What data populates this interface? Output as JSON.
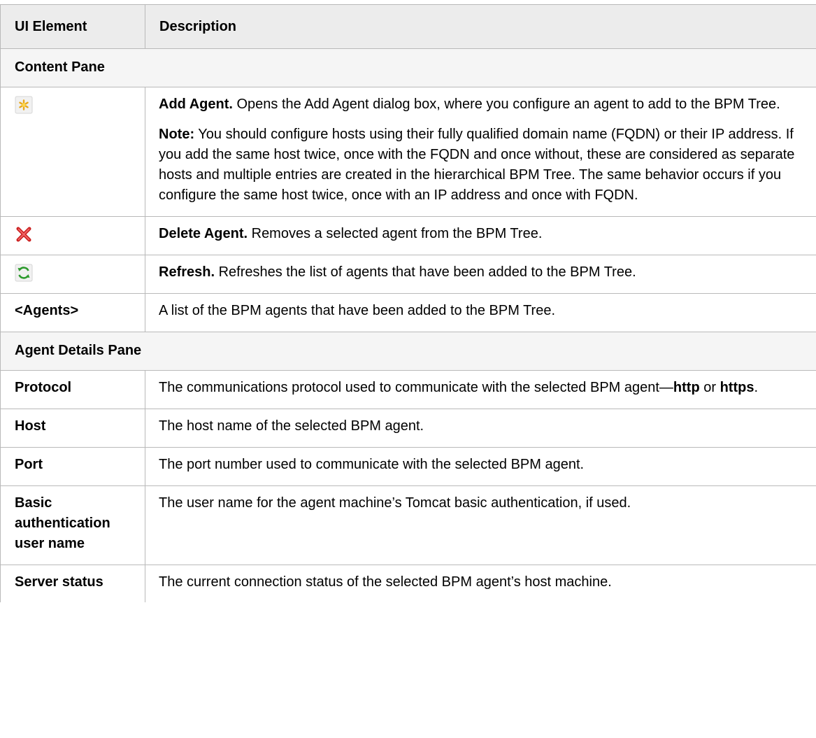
{
  "header": {
    "col1": "UI Element",
    "col2": "Description"
  },
  "sections": {
    "content_pane": "Content Pane",
    "agent_details_pane": "Agent Details Pane"
  },
  "rows": {
    "add_agent": {
      "icon": "add-star-icon",
      "title": "Add Agent.",
      "text": " Opens the Add Agent dialog box, where you configure an agent to add to the BPM Tree.",
      "note_label": "Note:",
      "note_text": " You should configure hosts using their fully qualified domain name (FQDN) or their IP address. If you add the same host twice, once with the FQDN and once without, these are considered as separate hosts and multiple entries are created in the hierarchical BPM Tree. The same behavior occurs if you configure the same host twice, once with an IP address and once with FQDN."
    },
    "delete_agent": {
      "icon": "delete-x-icon",
      "title": "Delete Agent.",
      "text": " Removes a selected agent from the BPM Tree."
    },
    "refresh": {
      "icon": "refresh-icon",
      "title": "Refresh.",
      "text": " Refreshes the list of agents that have been added to the BPM Tree."
    },
    "agents": {
      "label": "<Agents>",
      "text": "A list of the BPM agents that have been added to the BPM Tree."
    },
    "protocol": {
      "label": "Protocol",
      "text_before": "The communications protocol used to communicate with the selected BPM agent—",
      "http": "http",
      "or": " or ",
      "https": "https",
      "end": "."
    },
    "host": {
      "label": "Host",
      "text": "The host name of the selected BPM agent."
    },
    "port": {
      "label": "Port",
      "text": "The port number used to communicate with the selected BPM agent."
    },
    "basic_auth": {
      "label": "Basic authentication user name",
      "text": "The user name for the agent machine’s Tomcat basic authentication, if used."
    },
    "server_status": {
      "label": "Server status",
      "text": "The current connection status of the selected BPM agent’s host machine."
    }
  },
  "colors": {
    "header_bg": "#ececec",
    "section_bg": "#f5f5f5",
    "border": "#b9b9b9"
  }
}
